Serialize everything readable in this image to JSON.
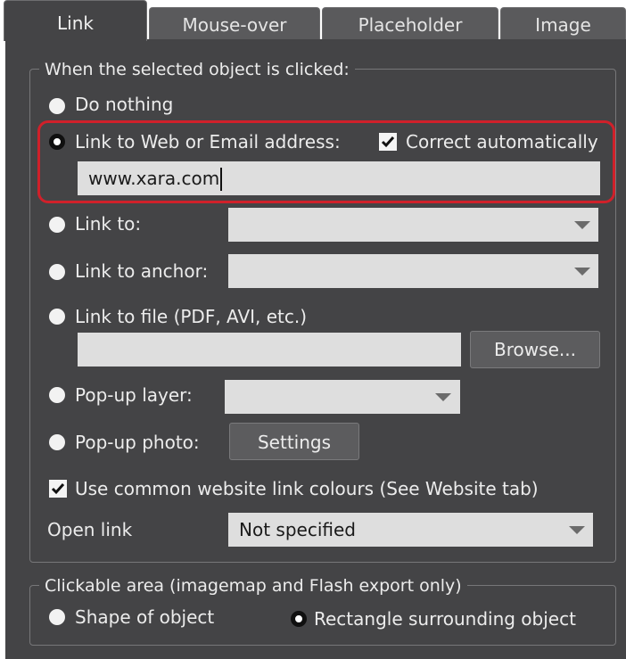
{
  "tabs": [
    {
      "label": "Link",
      "active": true
    },
    {
      "label": "Mouse-over",
      "active": false
    },
    {
      "label": "Placeholder",
      "active": false
    },
    {
      "label": "Image",
      "active": false
    }
  ],
  "click_group": {
    "title": "When the selected object is clicked:",
    "do_nothing": {
      "label": "Do nothing",
      "selected": false
    },
    "link_web": {
      "label": "Link to Web or Email address:",
      "selected": true,
      "correct_auto_label": "Correct automatically",
      "correct_auto_checked": true,
      "value": "www.xara.com"
    },
    "link_to": {
      "label": "Link to:",
      "selected": false,
      "value": ""
    },
    "link_anchor": {
      "label": "Link to anchor:",
      "selected": false,
      "value": ""
    },
    "link_file": {
      "label": "Link to file (PDF, AVI, etc.)",
      "selected": false,
      "value": "",
      "browse_label": "Browse..."
    },
    "popup_layer": {
      "label": "Pop-up layer:",
      "selected": false,
      "value": ""
    },
    "popup_photo": {
      "label": "Pop-up photo:",
      "selected": false,
      "settings_label": "Settings"
    },
    "common_colours": {
      "label": "Use common website link colours (See Website tab)",
      "checked": true
    },
    "open_link": {
      "label": "Open link",
      "value": "Not specified"
    }
  },
  "clickable_group": {
    "title": "Clickable area (imagemap and Flash export only)",
    "shape_of_object": {
      "label": "Shape of object",
      "selected": false
    },
    "rectangle": {
      "label": "Rectangle surrounding object",
      "selected": true
    }
  },
  "colors": {
    "panel": "#444446",
    "highlight": "#d0202a",
    "field": "#dedede"
  }
}
